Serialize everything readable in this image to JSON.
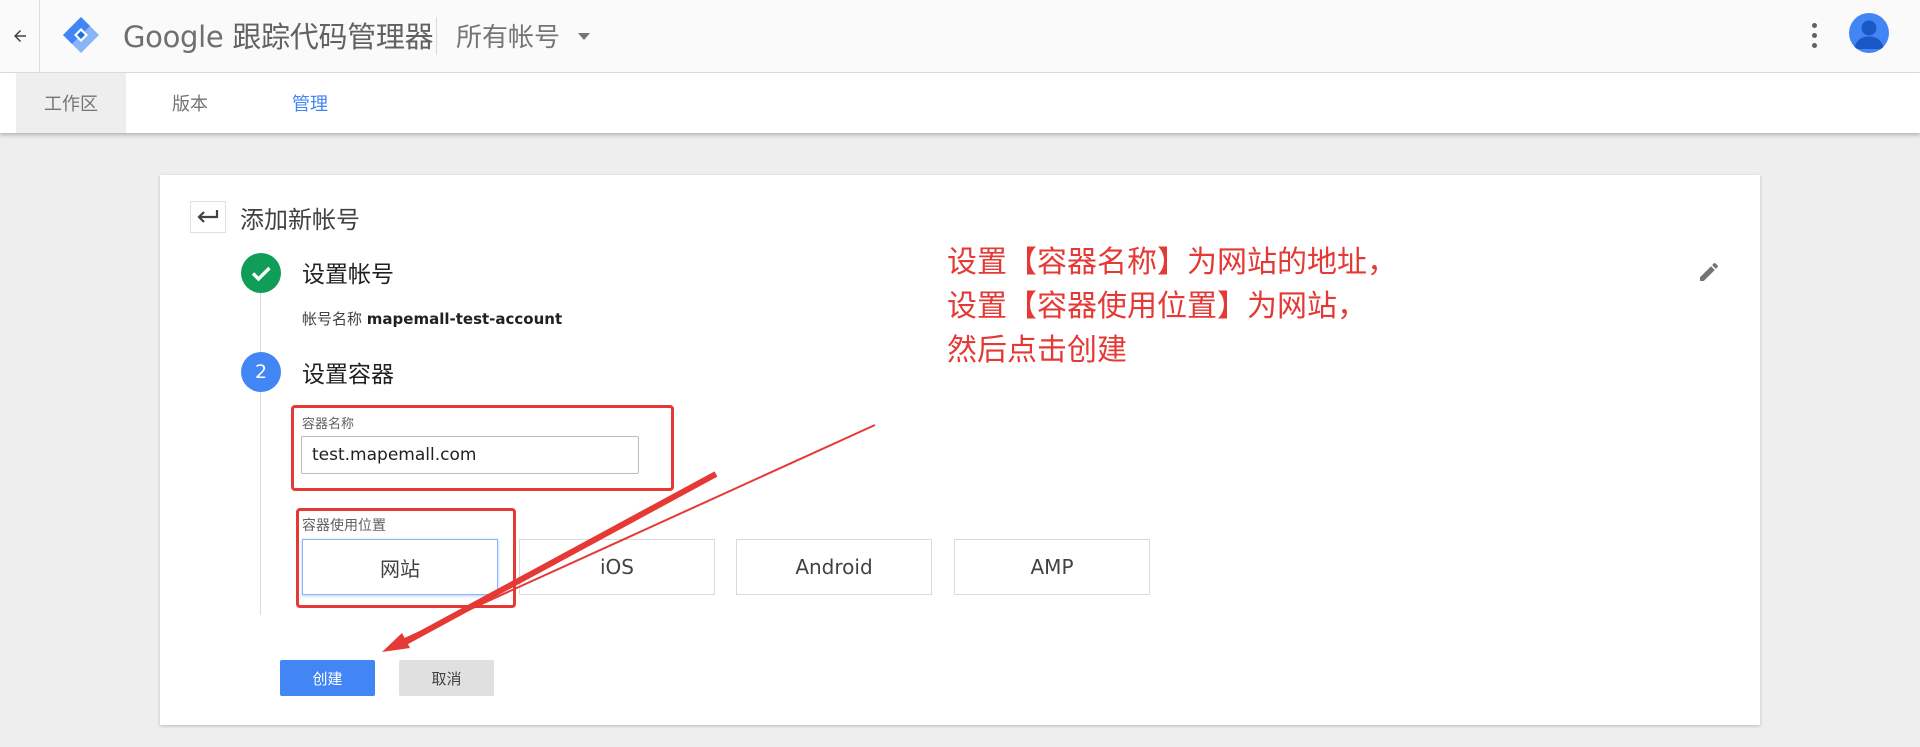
{
  "header": {
    "app_title_brand": "Google",
    "app_title_product": "跟踪代码管理器",
    "account_selector": "所有帐号"
  },
  "tabs": [
    {
      "label": "工作区"
    },
    {
      "label": "版本"
    },
    {
      "label": "管理"
    }
  ],
  "card": {
    "title": "添加新帐号",
    "step1": {
      "title": "设置帐号",
      "detail_label": "帐号名称",
      "detail_value": "mapemall-test-account"
    },
    "step2": {
      "number": "2",
      "title": "设置容器",
      "name_label": "容器名称",
      "name_value": "test.mapemall.com",
      "usage_label": "容器使用位置",
      "usage_options": [
        "网站",
        "iOS",
        "Android",
        "AMP"
      ],
      "selected_usage": "网站"
    },
    "create_button": "创建",
    "cancel_button": "取消"
  },
  "annotation": {
    "lines": [
      "设置【容器名称】为网站的地址，",
      "设置【容器使用位置】为网站，",
      "然后点击创建"
    ],
    "color": "#e53935"
  },
  "colors": {
    "primary_blue": "#4285f4",
    "success_green": "#0f9d58",
    "background": "#eeeeee"
  }
}
